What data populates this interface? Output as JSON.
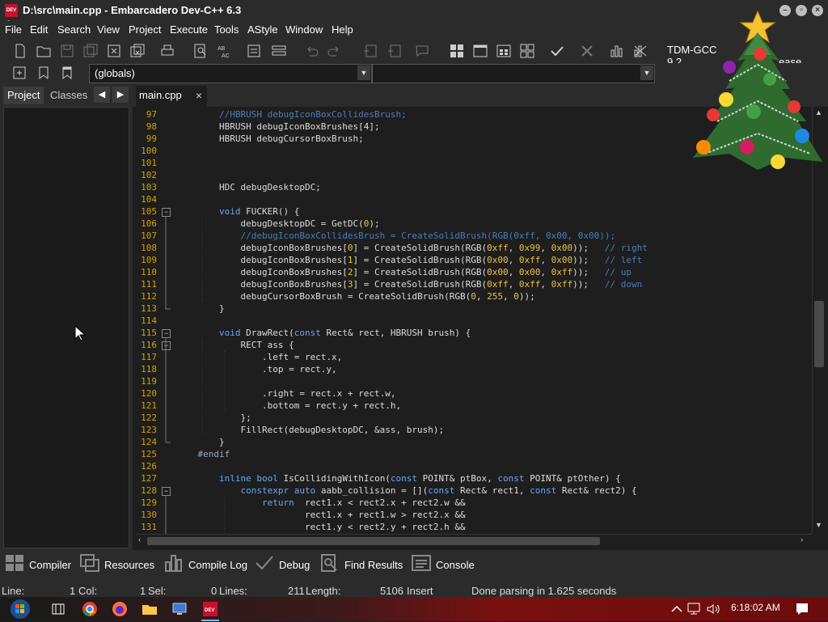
{
  "window": {
    "title": "D:\\src\\main.cpp - Embarcadero Dev-C++ 6.3",
    "app_icon_text": "DEV C++"
  },
  "menu": [
    "File",
    "Edit",
    "Search",
    "View",
    "Project",
    "Execute",
    "Tools",
    "AStyle",
    "Window",
    "Help"
  ],
  "toolbar": {
    "compiler": "TDM-GCC 9.2.0 64-bit Release",
    "compiler_visible": "TDM-GCC 9.2",
    "compiler_visible_tail": "ease"
  },
  "scope_combo": {
    "value": "(globals)"
  },
  "side_tabs": [
    "Project",
    "Classes"
  ],
  "file_tab": {
    "name": "main.cpp"
  },
  "editor": {
    "lines": [
      {
        "n": "97",
        "segs": [
          [
            "        ",
            "t"
          ],
          [
            "//HBRUSH debugIconBoxCollidesBrush;",
            "com"
          ]
        ]
      },
      {
        "n": "98",
        "segs": [
          [
            "        HBRUSH debugIconBoxBrushes[4];",
            "t"
          ]
        ]
      },
      {
        "n": "99",
        "segs": [
          [
            "        HBRUSH debugCursorBoxBrush;",
            "t"
          ]
        ]
      },
      {
        "n": "100",
        "segs": []
      },
      {
        "n": "101",
        "segs": []
      },
      {
        "n": "102",
        "segs": []
      },
      {
        "n": "103",
        "segs": [
          [
            "        HDC debugDesktopDC;",
            "t"
          ]
        ]
      },
      {
        "n": "104",
        "segs": []
      },
      {
        "n": "105",
        "fold": "-",
        "segs": [
          [
            "        ",
            "t"
          ],
          [
            "void",
            "kw"
          ],
          [
            " FUCKER() {",
            "t"
          ]
        ]
      },
      {
        "n": "106",
        "segs": [
          [
            "            debugDesktopDC = GetDC(",
            "t"
          ],
          [
            "0",
            "num"
          ],
          [
            ");",
            "t"
          ]
        ]
      },
      {
        "n": "107",
        "segs": [
          [
            "            ",
            "t"
          ],
          [
            "//debugIconBoxCollidesBrush = CreateSolidBrush(RGB(0xff, 0x00, 0x00));",
            "com"
          ]
        ]
      },
      {
        "n": "108",
        "segs": [
          [
            "            debugIconBoxBrushes[",
            "t"
          ],
          [
            "0",
            "num"
          ],
          [
            "] = CreateSolidBrush(RGB(",
            "t"
          ],
          [
            "0xff",
            "num"
          ],
          [
            ", ",
            "t"
          ],
          [
            "0x99",
            "num"
          ],
          [
            ", ",
            "t"
          ],
          [
            "0x00",
            "num"
          ],
          [
            "));   ",
            "t"
          ],
          [
            "// right",
            "com"
          ]
        ]
      },
      {
        "n": "109",
        "segs": [
          [
            "            debugIconBoxBrushes[",
            "t"
          ],
          [
            "1",
            "num"
          ],
          [
            "] = CreateSolidBrush(RGB(",
            "t"
          ],
          [
            "0x00",
            "num"
          ],
          [
            ", ",
            "t"
          ],
          [
            "0xff",
            "num"
          ],
          [
            ", ",
            "t"
          ],
          [
            "0x00",
            "num"
          ],
          [
            "));   ",
            "t"
          ],
          [
            "// left",
            "com"
          ]
        ]
      },
      {
        "n": "110",
        "segs": [
          [
            "            debugIconBoxBrushes[",
            "t"
          ],
          [
            "2",
            "num"
          ],
          [
            "] = CreateSolidBrush(RGB(",
            "t"
          ],
          [
            "0x00",
            "num"
          ],
          [
            ", ",
            "t"
          ],
          [
            "0x00",
            "num"
          ],
          [
            ", ",
            "t"
          ],
          [
            "0xff",
            "num"
          ],
          [
            "));   ",
            "t"
          ],
          [
            "// up",
            "com"
          ]
        ]
      },
      {
        "n": "111",
        "segs": [
          [
            "            debugIconBoxBrushes[",
            "t"
          ],
          [
            "3",
            "num"
          ],
          [
            "] = CreateSolidBrush(RGB(",
            "t"
          ],
          [
            "0xff",
            "num"
          ],
          [
            ", ",
            "t"
          ],
          [
            "0xff",
            "num"
          ],
          [
            ", ",
            "t"
          ],
          [
            "0xff",
            "num"
          ],
          [
            "));   ",
            "t"
          ],
          [
            "// down",
            "com"
          ]
        ]
      },
      {
        "n": "112",
        "segs": [
          [
            "            debugCursorBoxBrush = CreateSolidBrush(RGB(",
            "t"
          ],
          [
            "0",
            "num"
          ],
          [
            ", ",
            "t"
          ],
          [
            "255",
            "num"
          ],
          [
            ", ",
            "t"
          ],
          [
            "0",
            "num"
          ],
          [
            "));",
            "t"
          ]
        ]
      },
      {
        "n": "113",
        "segs": [
          [
            "        }",
            "t"
          ]
        ]
      },
      {
        "n": "114",
        "segs": []
      },
      {
        "n": "115",
        "fold": "-",
        "segs": [
          [
            "        ",
            "t"
          ],
          [
            "void",
            "kw"
          ],
          [
            " DrawRect(",
            "t"
          ],
          [
            "const",
            "kw"
          ],
          [
            " Rect& rect, HBRUSH brush) {",
            "t"
          ]
        ]
      },
      {
        "n": "116",
        "fold": "-",
        "segs": [
          [
            "            RECT ass {",
            "t"
          ]
        ]
      },
      {
        "n": "117",
        "segs": [
          [
            "                .left = rect.x,",
            "t"
          ]
        ]
      },
      {
        "n": "118",
        "segs": [
          [
            "                .top = rect.y,",
            "t"
          ]
        ]
      },
      {
        "n": "119",
        "segs": []
      },
      {
        "n": "120",
        "segs": [
          [
            "                .right = rect.x + rect.w,",
            "t"
          ]
        ]
      },
      {
        "n": "121",
        "segs": [
          [
            "                .bottom = rect.y + rect.h,",
            "t"
          ]
        ]
      },
      {
        "n": "122",
        "segs": [
          [
            "            };",
            "t"
          ]
        ]
      },
      {
        "n": "123",
        "segs": [
          [
            "            FillRect(debugDesktopDC, &ass, brush);",
            "t"
          ]
        ]
      },
      {
        "n": "124",
        "segs": [
          [
            "        }",
            "t"
          ]
        ]
      },
      {
        "n": "125",
        "segs": [
          [
            "    ",
            "t"
          ],
          [
            "#endif",
            "pp"
          ]
        ]
      },
      {
        "n": "126",
        "segs": []
      },
      {
        "n": "127",
        "segs": [
          [
            "        ",
            "t"
          ],
          [
            "inline",
            "kw"
          ],
          [
            " ",
            "t"
          ],
          [
            "bool",
            "kw"
          ],
          [
            " IsCollidingWithIcon(",
            "t"
          ],
          [
            "const",
            "kw"
          ],
          [
            " POINT& ptBox, ",
            "t"
          ],
          [
            "const",
            "kw"
          ],
          [
            " POINT& ptOther) {",
            "t"
          ]
        ]
      },
      {
        "n": "128",
        "fold": "-",
        "segs": [
          [
            "            ",
            "t"
          ],
          [
            "constexpr",
            "kw"
          ],
          [
            " ",
            "t"
          ],
          [
            "auto",
            "kw"
          ],
          [
            " aabb_collision = [](",
            "t"
          ],
          [
            "const",
            "kw"
          ],
          [
            " Rect& rect1, ",
            "t"
          ],
          [
            "const",
            "kw"
          ],
          [
            " Rect& rect2) {",
            "t"
          ]
        ]
      },
      {
        "n": "129",
        "segs": [
          [
            "                ",
            "t"
          ],
          [
            "return",
            "kw"
          ],
          [
            "  rect1.x < rect2.x + rect2.w &&",
            "t"
          ]
        ]
      },
      {
        "n": "130",
        "segs": [
          [
            "                        rect1.x + rect1.w > rect2.x &&",
            "t"
          ]
        ]
      },
      {
        "n": "131",
        "segs": [
          [
            "                        rect1.y < rect2.y + rect2.h &&",
            "t"
          ]
        ]
      }
    ]
  },
  "bottom_tabs": [
    "Compiler",
    "Resources",
    "Compile Log",
    "Debug",
    "Find Results",
    "Console"
  ],
  "status": {
    "line_label": "Line:",
    "line_value": "1",
    "col_label": "Col:",
    "col_value": "1",
    "sel_label": "Sel:",
    "sel_value": "0",
    "lines_label": "Lines:",
    "lines_value": "211",
    "length_label": "Length:",
    "length_value": "5106",
    "mode": "Insert",
    "message": "Done parsing in 1.625 seconds"
  },
  "taskbar": {
    "time": "6:18:02 AM"
  }
}
